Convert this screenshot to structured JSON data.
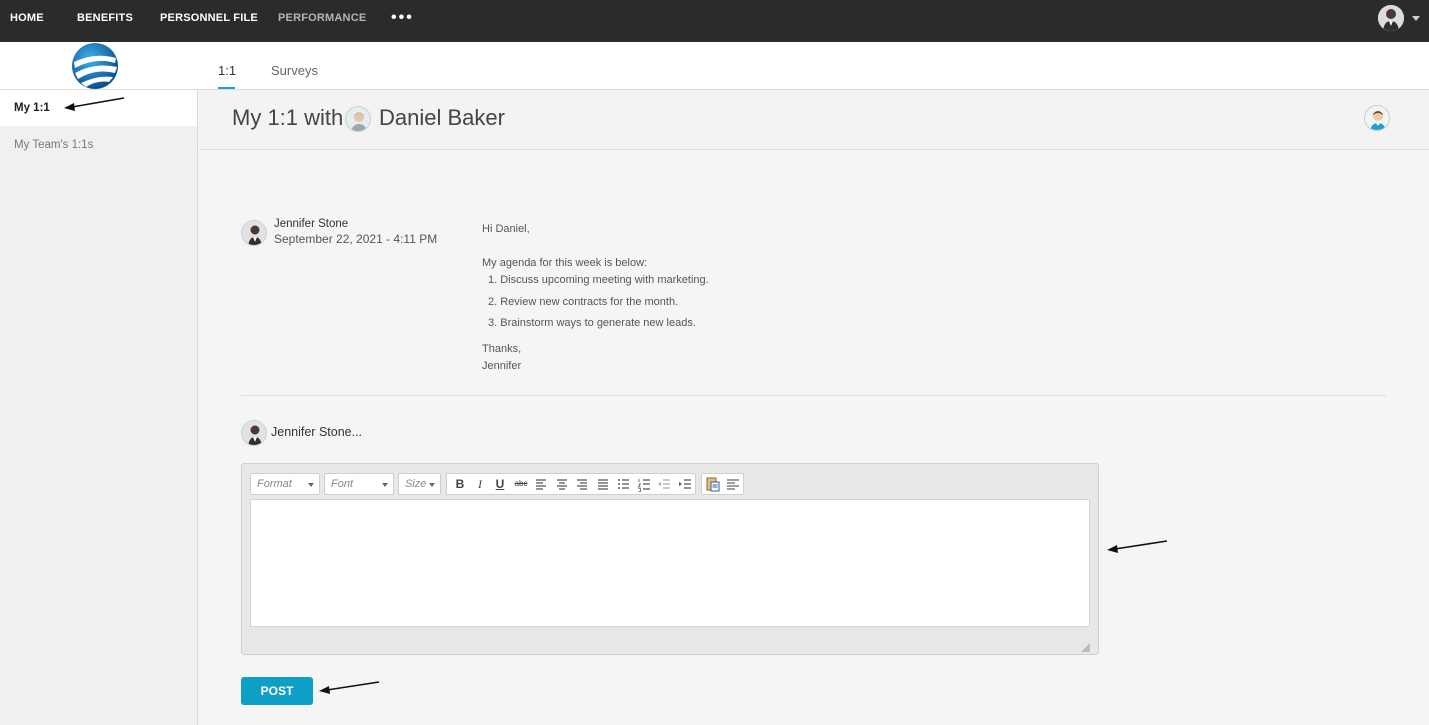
{
  "topnav": {
    "items": [
      {
        "label": "HOME",
        "muted": false
      },
      {
        "label": "BENEFITS",
        "muted": false
      },
      {
        "label": "PERSONNEL FILE",
        "muted": false
      },
      {
        "label": "PERFORMANCE",
        "muted": true
      }
    ],
    "more_label": "•••",
    "more_icon": "ellipsis-icon",
    "user_menu_icon": "chevron-down-icon"
  },
  "tabs": [
    {
      "label": "1:1",
      "active": true
    },
    {
      "label": "Surveys",
      "active": false
    }
  ],
  "sidebar": {
    "items": [
      {
        "label": "My 1:1",
        "active": true
      },
      {
        "label": "My Team's 1:1s",
        "active": false
      }
    ]
  },
  "header": {
    "title_prefix": "My 1:1 with",
    "partner_name": "Daniel Baker"
  },
  "message": {
    "author": "Jennifer Stone",
    "date": "September 22, 2021 - 4:11 PM",
    "greeting": "Hi Daniel,",
    "intro": "My agenda for this week is below:",
    "agenda": [
      "1. Discuss upcoming meeting with marketing.",
      "2. Review new contracts for the month.",
      "3. Brainstorm ways to generate new leads."
    ],
    "closing": "Thanks,",
    "signature": "Jennifer"
  },
  "composer": {
    "author_placeholder": "Jennifer Stone...",
    "toolbar": {
      "format": "Format",
      "font": "Font",
      "size": "Size",
      "bold": "B",
      "italic": "I",
      "underline": "U",
      "strike": "abc"
    },
    "body_value": "",
    "post_label": "POST"
  },
  "colors": {
    "accent": "#0e9fc6",
    "topbar": "#2b2b2b"
  }
}
